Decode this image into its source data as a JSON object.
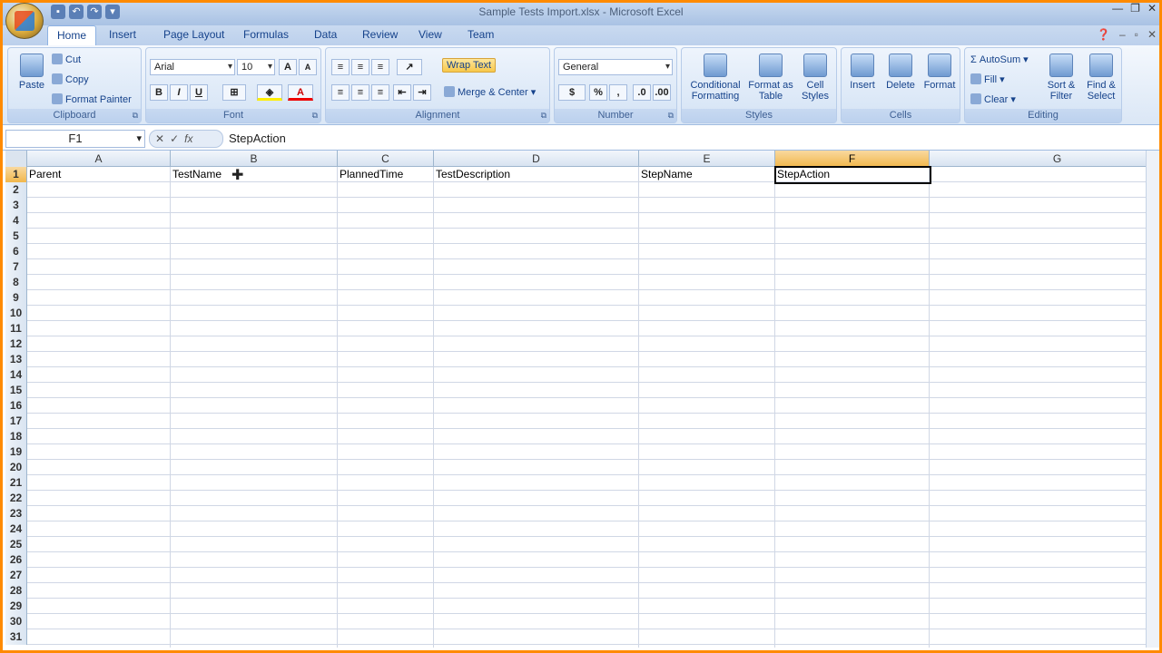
{
  "window": {
    "title": "Sample Tests Import.xlsx - Microsoft Excel"
  },
  "tabs": [
    "Home",
    "Insert",
    "Page Layout",
    "Formulas",
    "Data",
    "Review",
    "View",
    "Team"
  ],
  "clipboard": {
    "paste": "Paste",
    "cut": "Cut",
    "copy": "Copy",
    "format_painter": "Format Painter",
    "group": "Clipboard"
  },
  "font": {
    "name": "Arial",
    "size": "10",
    "group": "Font"
  },
  "alignment": {
    "wrap": "Wrap Text",
    "merge": "Merge & Center",
    "group": "Alignment"
  },
  "number": {
    "format": "General",
    "group": "Number"
  },
  "styles": {
    "conditional": "Conditional Formatting",
    "format_table": "Format as Table",
    "cell_styles": "Cell Styles",
    "group": "Styles"
  },
  "cells": {
    "insert": "Insert",
    "delete": "Delete",
    "format": "Format",
    "group": "Cells"
  },
  "editing": {
    "autosum": "AutoSum",
    "fill": "Fill",
    "clear": "Clear",
    "sort": "Sort & Filter",
    "find": "Find & Select",
    "group": "Editing"
  },
  "formula_bar": {
    "name_box": "F1",
    "value": "StepAction"
  },
  "columns": [
    "A",
    "B",
    "C",
    "D",
    "E",
    "F",
    "G"
  ],
  "row1": [
    "Parent",
    "TestName",
    "PlannedTime",
    "TestDescription",
    "StepName",
    "StepAction"
  ],
  "rows": [
    "1",
    "2",
    "3",
    "4",
    "5",
    "6",
    "7",
    "8",
    "9",
    "10",
    "11",
    "12",
    "13",
    "14",
    "15",
    "16",
    "17",
    "18",
    "19",
    "20",
    "21",
    "22",
    "23",
    "24",
    "25",
    "26",
    "27",
    "28",
    "29",
    "30",
    "31"
  ],
  "selected_cell": "F1",
  "accent_color": "#f1b74c"
}
